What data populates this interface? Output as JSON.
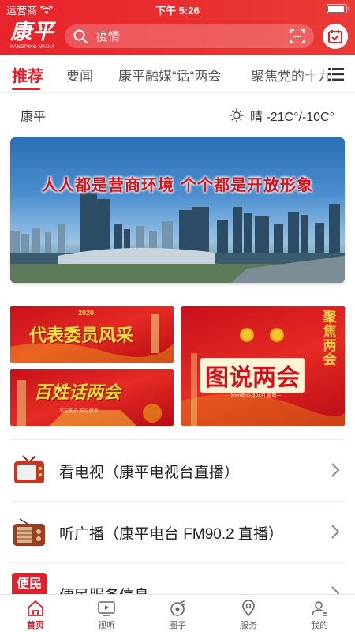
{
  "status_bar": {
    "carrier": "运营商",
    "time": "下午 5:26"
  },
  "header": {
    "logo_text": "康平",
    "logo_sub": "KANGPING MADIA",
    "search_placeholder": "疫情"
  },
  "tabs": [
    {
      "label": "推荐",
      "active": true
    },
    {
      "label": "要闻",
      "active": false
    },
    {
      "label": "康平融媒“话“两会",
      "active": false
    },
    {
      "label": "聚焦党的十九",
      "active": false
    }
  ],
  "weather": {
    "city": "康平",
    "condition": "晴 -21C°/-10C°"
  },
  "hero": {
    "slogan": "人人都是营商环境  个个都是开放形象"
  },
  "tiles": {
    "a": {
      "title": "代表委员风采",
      "year": "2020"
    },
    "b": {
      "title": "百姓话两会",
      "caption": "不忘初心 牢记使命"
    },
    "c": {
      "title": "图说两会",
      "vertical": "聚焦两会",
      "date": "2020年12月28日 星期一"
    }
  },
  "list": [
    {
      "label": "看电视（康平电视台直播）",
      "icon": "tv-icon"
    },
    {
      "label": "听广播（康平电台 FM90.2 直播）",
      "icon": "radio-icon"
    },
    {
      "label": "便民服务信息",
      "icon": "service-icon",
      "badge": "便民"
    }
  ],
  "bottom_nav": [
    {
      "label": "首页",
      "icon": "home-icon",
      "active": true
    },
    {
      "label": "视听",
      "icon": "tv-play-icon",
      "active": false
    },
    {
      "label": "圈子",
      "icon": "circle-icon",
      "active": false
    },
    {
      "label": "服务",
      "icon": "location-icon",
      "active": false
    },
    {
      "label": "我的",
      "icon": "profile-icon",
      "active": false
    }
  ],
  "colors": {
    "brand_red": "#e41f2c",
    "header_red": "#e7232b"
  }
}
